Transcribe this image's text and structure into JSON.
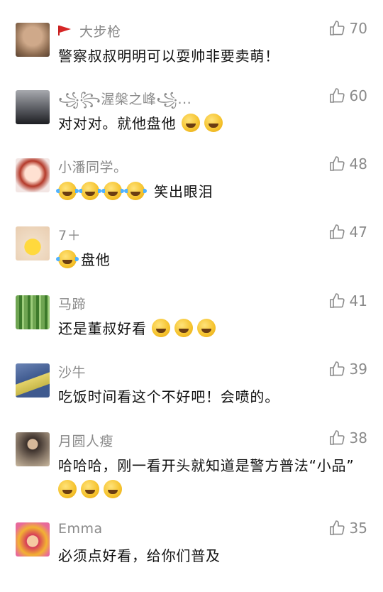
{
  "comments": [
    {
      "name": "大步枪",
      "text": "警察叔叔明明可以耍帅非要卖萌！",
      "likes": "70"
    },
    {
      "name": "꧁꧂渥槃之峰꧁...",
      "text": "对对对。就他盘他",
      "likes": "60"
    },
    {
      "name": "小潘同学。",
      "text": "笑出眼泪",
      "likes": "48"
    },
    {
      "name": "7＋",
      "text": "盘他",
      "likes": "47"
    },
    {
      "name": "马蹄",
      "text": "还是董叔好看",
      "likes": "41"
    },
    {
      "name": "沙牛",
      "text": "吃饭时间看这个不好吧！会喷的。",
      "likes": "39"
    },
    {
      "name": "月圆人瘦",
      "text": "哈哈哈，刚一看开头就知道是警方普法“小品”",
      "likes": "38"
    },
    {
      "name": "Emma",
      "text": "必须点好看，给你们普及",
      "likes": "35"
    }
  ],
  "icons": {
    "like": "thumbs-up-outline-icon",
    "flag": "red-flag-icon",
    "emoji": "laughing-face-emoji"
  },
  "colors": {
    "name": "#8a8a8a",
    "text": "#111111",
    "likes": "#8a8a8a"
  }
}
